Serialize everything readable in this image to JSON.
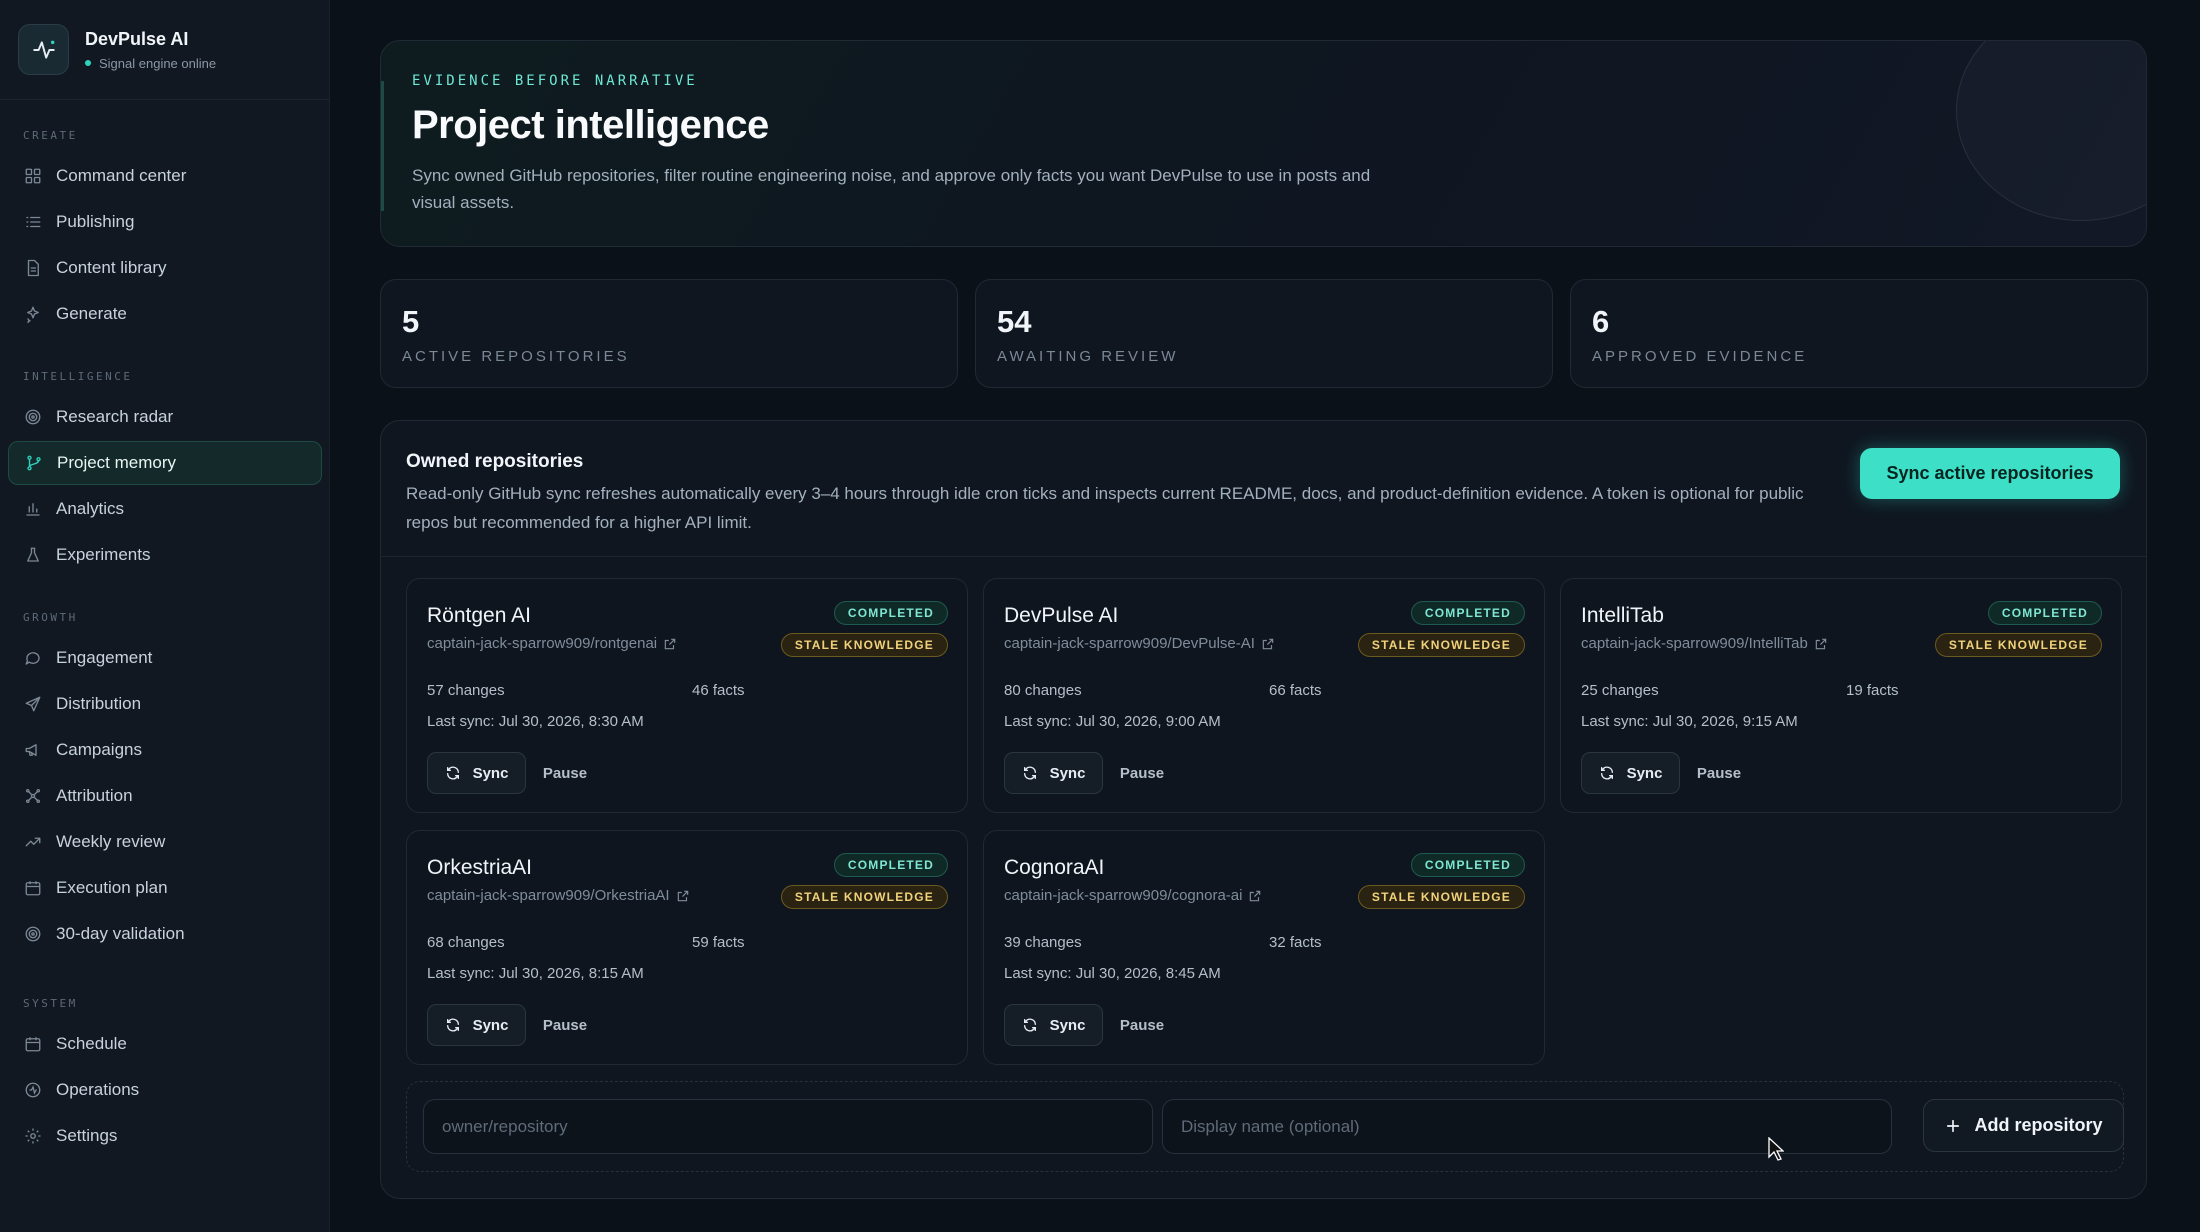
{
  "brand": {
    "name": "DevPulse AI",
    "status": "Signal engine online"
  },
  "nav": {
    "sections": [
      {
        "heading": "CREATE",
        "items": [
          "Command center",
          "Publishing",
          "Content library",
          "Generate"
        ]
      },
      {
        "heading": "INTELLIGENCE",
        "items": [
          "Research radar",
          "Project memory",
          "Analytics",
          "Experiments"
        ]
      },
      {
        "heading": "GROWTH",
        "items": [
          "Engagement",
          "Distribution",
          "Campaigns",
          "Attribution",
          "Weekly review",
          "Execution plan",
          "30-day validation"
        ]
      },
      {
        "heading": "SYSTEM",
        "items": [
          "Schedule",
          "Operations",
          "Settings"
        ]
      }
    ],
    "active": "Project memory"
  },
  "hero": {
    "eyebrow": "EVIDENCE BEFORE NARRATIVE",
    "title": "Project intelligence",
    "description": "Sync owned GitHub repositories, filter routine engineering noise, and approve only facts you want DevPulse to use in posts and visual assets."
  },
  "stats": [
    {
      "value": "5",
      "label": "ACTIVE REPOSITORIES"
    },
    {
      "value": "54",
      "label": "AWAITING REVIEW"
    },
    {
      "value": "6",
      "label": "APPROVED EVIDENCE"
    }
  ],
  "repos_panel": {
    "title": "Owned repositories",
    "description": "Read-only GitHub sync refreshes automatically every 3–4 hours through idle cron ticks and inspects current README, docs, and product-definition evidence. A token is optional for public repos but recommended for a higher API limit.",
    "sync_all_label": "Sync active repositories"
  },
  "repos": [
    {
      "name": "Röntgen AI",
      "repo": "captain-jack-sparrow909/rontgenai",
      "status": "COMPLETED",
      "knowledge": "STALE KNOWLEDGE",
      "changes": "57 changes",
      "facts": "46 facts",
      "last_sync": "Last sync: Jul 30, 2026, 8:30 AM",
      "sync_label": "Sync",
      "pause_label": "Pause"
    },
    {
      "name": "DevPulse AI",
      "repo": "captain-jack-sparrow909/DevPulse-AI",
      "status": "COMPLETED",
      "knowledge": "STALE KNOWLEDGE",
      "changes": "80 changes",
      "facts": "66 facts",
      "last_sync": "Last sync: Jul 30, 2026, 9:00 AM",
      "sync_label": "Sync",
      "pause_label": "Pause"
    },
    {
      "name": "IntelliTab",
      "repo": "captain-jack-sparrow909/IntelliTab",
      "status": "COMPLETED",
      "knowledge": "STALE KNOWLEDGE",
      "changes": "25 changes",
      "facts": "19 facts",
      "last_sync": "Last sync: Jul 30, 2026, 9:15 AM",
      "sync_label": "Sync",
      "pause_label": "Pause"
    },
    {
      "name": "OrkestriaAI",
      "repo": "captain-jack-sparrow909/OrkestriaAI",
      "status": "COMPLETED",
      "knowledge": "STALE KNOWLEDGE",
      "changes": "68 changes",
      "facts": "59 facts",
      "last_sync": "Last sync: Jul 30, 2026, 8:15 AM",
      "sync_label": "Sync",
      "pause_label": "Pause"
    },
    {
      "name": "CognoraAI",
      "repo": "captain-jack-sparrow909/cognora-ai",
      "status": "COMPLETED",
      "knowledge": "STALE KNOWLEDGE",
      "changes": "39 changes",
      "facts": "32 facts",
      "last_sync": "Last sync: Jul 30, 2026, 8:45 AM",
      "sync_label": "Sync",
      "pause_label": "Pause"
    }
  ],
  "add_form": {
    "repo_placeholder": "owner/repository",
    "display_placeholder": "Display name (optional)",
    "add_label": "Add repository"
  },
  "colors": {
    "accent": "#3de0c6",
    "background": "#0b1119",
    "sidebar": "#111821",
    "stale": "#f1d27a",
    "completed": "#7ee6d2"
  }
}
